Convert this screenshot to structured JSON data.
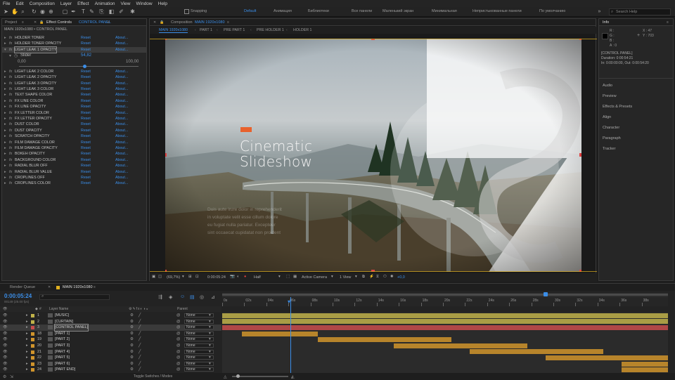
{
  "menu": [
    "File",
    "Edit",
    "Composition",
    "Layer",
    "Effect",
    "Animation",
    "View",
    "Window",
    "Help"
  ],
  "toolbar": {
    "snapping": "Snapping",
    "workspaces": [
      "Default",
      "Анимация",
      "Библиотеки",
      "Все панели",
      "Маленький экран",
      "Минимальная",
      "Непристыкованные панели",
      "По умолчанию"
    ],
    "active_workspace": "Default",
    "search_placeholder": "Search Help"
  },
  "left_panel": {
    "tabs": [
      "Project",
      "Effect Controls",
      "CONTROL PANEL"
    ],
    "header": "MAIN 1920x1080 • CONTROL PANEL",
    "reset_label": "Reset",
    "about_label": "About...",
    "effects": [
      "HOLDER TONER",
      "HOLDER TONER OPACITY",
      "LIGHT LEAK 1 OPACITY"
    ],
    "slider": {
      "label": "Slider",
      "value": "54,82",
      "min": "0,00",
      "max": "100,00",
      "level": 0.548
    },
    "effects2": [
      "LIGHT LEAK 2 COLOR",
      "LIGHT LEAK 2 OPACITY",
      "LIGHT LEAK 3 OPACITY",
      "LIGHT LEAK 3 COLOR",
      "TEXT SHAPE COLOR",
      "FX LINE COLOR",
      "FX LINE OPACITY",
      "FX LETTER COLOR",
      "FX LETTER OPACITY",
      "DUST COLOR",
      "DUST OPACITY",
      "SCRATCH OPACITY",
      "FILM DAMAGE COLOR",
      "FILM DAMAGE OPACITY",
      "BOKEH OPACITY",
      "BACKGROUND COLOR",
      "RADIAL BLUR OFF",
      "RADIAL BLUR VALUE",
      "CROPLINES OFF",
      "CROPLINES COLOR"
    ]
  },
  "comp_panel": {
    "title_prefix": "Composition",
    "title": "MAIN 1920x1080",
    "crumbs": [
      "MAIN 1920x1080",
      "PART 1",
      "PRE PART 1",
      "PRE HOLDER 1",
      "HOLDER 1"
    ],
    "headline_line1": "Cinematic",
    "headline_line2": "Slideshow",
    "body_lines": [
      "Duis aute irure dolor in reprehenderit",
      "in voluptate velit esse cillum dolore",
      "eu fugiat nulla pariatur. Excepteur",
      "sint occaecat cupidatat non proident"
    ],
    "zoom": "(69,7%)",
    "timecode": "0:00:05:24",
    "resolution": "Half",
    "camera": "Active Camera",
    "view": "1 View",
    "exposure": "+0,0"
  },
  "right_panel": {
    "tab": "Info",
    "color_labels": [
      "R :",
      "G :",
      "B :",
      "A : 0"
    ],
    "coords": [
      "X : 47",
      "Y : 703"
    ],
    "info_lines": [
      "[CONTROL PANEL]",
      "Duration: 0:00:54:21",
      "In: 0:00:00:00, Out: 0:00:54:20"
    ],
    "sections": [
      "Audio",
      "Preview",
      "Effects & Presets",
      "Align",
      "Character",
      "Paragraph",
      "Tracker"
    ]
  },
  "timeline": {
    "tabs": [
      "Render Queue",
      "MAIN 1920x1080"
    ],
    "timecode": "0:00:05:24",
    "frame_info": "00149 (25.00 fps)",
    "col_layer_name": "Layer Name",
    "col_parent": "Parent",
    "ruler": [
      "0s",
      "02s",
      "04s",
      "06s",
      "08s",
      "10s",
      "12s",
      "14s",
      "16s",
      "18s",
      "20s",
      "22s",
      "24s",
      "26s",
      "28s",
      "30s",
      "32s",
      "34s",
      "36s",
      "38s"
    ],
    "layers": [
      {
        "num": "1",
        "name": "[MUSIC]",
        "color": "#c0b24a",
        "parent": "None"
      },
      {
        "num": "2",
        "name": "[CURTAIN]",
        "color": "#c0b24a",
        "parent": "None"
      },
      {
        "num": "3",
        "name": "[CONTROL PANEL]",
        "color": "#c84c4c",
        "parent": "None"
      },
      {
        "num": "18",
        "name": "[PART 1]",
        "color": "#d0942c",
        "parent": "None"
      },
      {
        "num": "19",
        "name": "[PART 2]",
        "color": "#d0942c",
        "parent": "None"
      },
      {
        "num": "20",
        "name": "[PART 3]",
        "color": "#d0942c",
        "parent": "None"
      },
      {
        "num": "21",
        "name": "[PART 4]",
        "color": "#d0942c",
        "parent": "None"
      },
      {
        "num": "22",
        "name": "[PART 5]",
        "color": "#d0942c",
        "parent": "None"
      },
      {
        "num": "23",
        "name": "[PART 6]",
        "color": "#d0942c",
        "parent": "None"
      },
      {
        "num": "24",
        "name": "[PART END]",
        "color": "#d0942c",
        "parent": "None"
      }
    ],
    "footer": "Toggle Switches / Modes"
  }
}
